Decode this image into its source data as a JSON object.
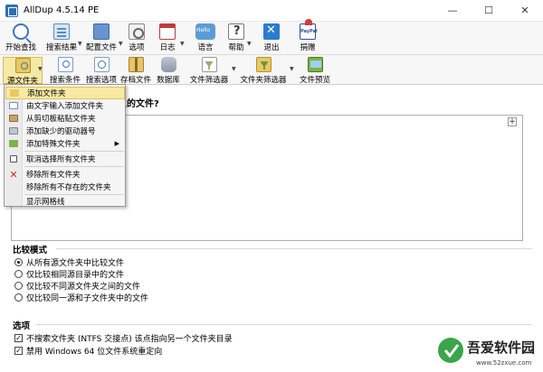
{
  "window": {
    "title": "AllDup 4.5.14 PE",
    "minimize": "—",
    "maximize": "☐",
    "close": "✕"
  },
  "toolbar": {
    "start_search": "开始查找",
    "search_results": "搜索结果",
    "config_file": "配置文件",
    "options": "选项",
    "log": "日志",
    "language": "语言",
    "help": "帮助",
    "exit": "退出",
    "donate": "捐赠"
  },
  "toolbar2": {
    "source_folder": "源文件夹",
    "search_conditions": "搜索条件",
    "search_options": "搜索选项",
    "archive_files": "存档文件",
    "database": "数据库",
    "file_filter": "文件筛选器",
    "folder_filter": "文件夹筛选器",
    "file_preview": "文件预览"
  },
  "main": {
    "question": "复的文件?",
    "compare_mode": {
      "title": "比较模式",
      "options": [
        "从所有源文件夹中比较文件",
        "仅比较相同源目录中的文件",
        "仅比较不同源文件夹之间的文件",
        "仅比较同一源和子文件夹中的文件"
      ],
      "selected_index": 0
    },
    "options_section": {
      "title": "选项",
      "items": [
        "不搜索文件夹 (NTFS 交接点) 该点指向另一个文件夹目录",
        "禁用 Windows 64 位文件系统重定向"
      ]
    }
  },
  "context_menu": {
    "items": [
      "添加文件夹",
      "由文字输入添加文件夹",
      "从剪切板粘贴文件夹",
      "添加缺少的驱动器号",
      "添加特殊文件夹",
      "取消选择所有文件夹",
      "移除所有文件夹",
      "移除所有不存在的文件夹",
      "显示网格线"
    ]
  },
  "watermark": {
    "brand": "吾爱软件园",
    "url": "www.52zxue.com"
  }
}
